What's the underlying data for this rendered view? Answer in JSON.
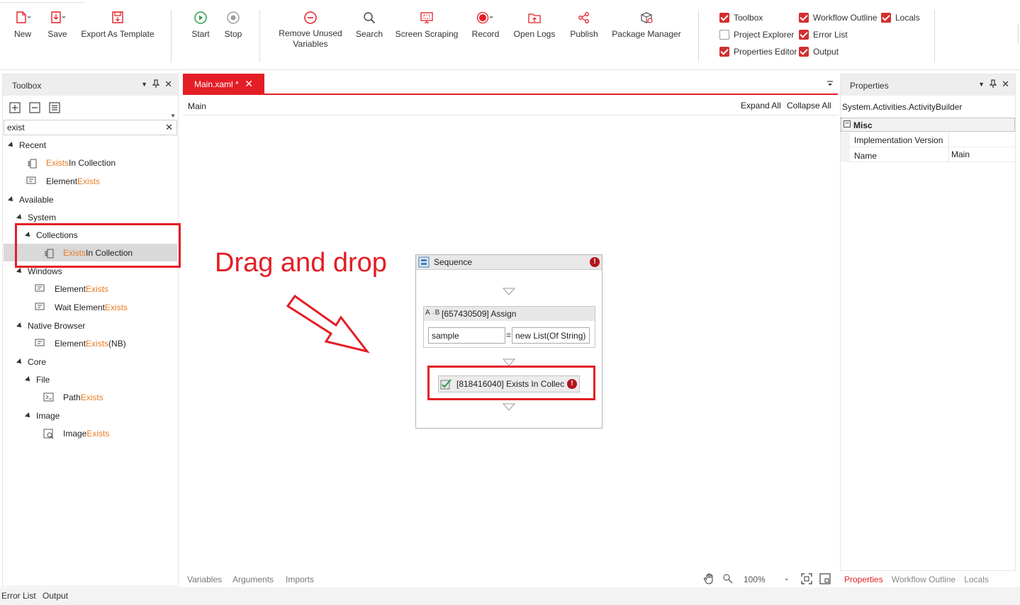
{
  "ribbon": {
    "new": "New",
    "save": "Save",
    "export_template": "Export As Template",
    "start": "Start",
    "stop": "Stop",
    "remove_unused_1": "Remove Unused",
    "remove_unused_2": "Variables",
    "search": "Search",
    "screen_scraping": "Screen Scraping",
    "record": "Record",
    "open_logs": "Open Logs",
    "publish": "Publish",
    "package_manager": "Package Manager",
    "panels": {
      "toolbox": {
        "label": "Toolbox",
        "checked": true
      },
      "project_explorer": {
        "label": "Project Explorer",
        "checked": false
      },
      "properties_editor": {
        "label": "Properties Editor",
        "checked": true
      },
      "workflow_outline": {
        "label": "Workflow Outline",
        "checked": true
      },
      "error_list": {
        "label": "Error List",
        "checked": true
      },
      "output": {
        "label": "Output",
        "checked": true
      },
      "locals": {
        "label": "Locals",
        "checked": true
      }
    }
  },
  "toolbox": {
    "title": "Toolbox",
    "search_value": "exist",
    "recent": "Recent",
    "available": "Available",
    "system": "System",
    "collections": "Collections",
    "windows": "Windows",
    "native_browser": "Native Browser",
    "core": "Core",
    "file": "File",
    "image": "Image",
    "items": {
      "recent_exists_in_collection": {
        "hl": "Exists",
        "rest": " In Collection"
      },
      "recent_element_exists": {
        "pre": "Element ",
        "hl": "Exists"
      },
      "collections_exists_in_collection": {
        "hl": "Exists",
        "rest": " In Collection"
      },
      "windows_element_exists": {
        "pre": "Element ",
        "hl": "Exists"
      },
      "windows_wait_element_exists": {
        "pre": "Wait Element ",
        "hl": "Exists"
      },
      "nb_element_exists": {
        "pre": "Element ",
        "hl": "Exists",
        "rest": " (NB)"
      },
      "file_path_exists": {
        "pre": "Path ",
        "hl": "Exists"
      },
      "image_exists": {
        "pre": "Image ",
        "hl": "Exists"
      }
    }
  },
  "designer": {
    "tab_label": "Main.xaml *",
    "breadcrumb": "Main",
    "expand_all": "Expand All",
    "collapse_all": "Collapse All",
    "sequence_title": "Sequence",
    "assign_title": "[657430509] Assign",
    "assign_left": "sample",
    "assign_eq": "=",
    "assign_right": "new List(Of String)",
    "exists_title": "[818416040] Exists In Collec",
    "annotation": "Drag and drop",
    "footer": {
      "variables": "Variables",
      "arguments": "Arguments",
      "imports": "Imports",
      "zoom": "100%"
    }
  },
  "properties": {
    "title": "Properties",
    "type": "System.Activities.ActivityBuilder",
    "category": "Misc",
    "rows": [
      {
        "name": "Implementation Version",
        "value": ""
      },
      {
        "name": "Name",
        "value": "Main"
      }
    ],
    "tabs": [
      "Properties",
      "Workflow Outline",
      "Locals"
    ]
  },
  "bottom": {
    "error_list": "Error List",
    "output": "Output"
  },
  "colors": {
    "accent": "#e31e26",
    "highlight": "#e87b22",
    "check": "#d32f2f"
  }
}
